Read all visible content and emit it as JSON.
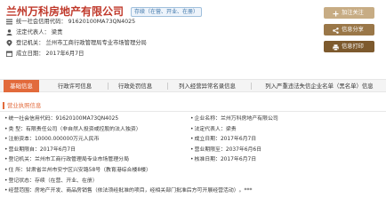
{
  "header": {
    "company_name": "兰州万科房地产有限公司",
    "status_badge": "存续（在营、开业、在册）",
    "credit_code_label": "统一社会信用代码：",
    "credit_code": "91620100MA73QN4025",
    "legal_rep_label": "法定代表人：",
    "legal_rep": "梁贵",
    "registry_label": "登记机关：",
    "registry": "兰州市工商行政管理局专业市场管理分局",
    "established_label": "成立日期：",
    "established": "2017年6月7日"
  },
  "actions": {
    "follow": "加注关注",
    "share": "信息分享",
    "print": "信息打印"
  },
  "tabs": [
    {
      "label": "基础信息"
    },
    {
      "label": "行政许可信息"
    },
    {
      "label": "行政处罚信息"
    },
    {
      "label": "列入经营异常名录信息"
    },
    {
      "label": "列入严重违法失信企业名单（黑名单）信息"
    }
  ],
  "section": {
    "title": "营业执照信息"
  },
  "details": {
    "credit_code_k": "统一社会信用代码：",
    "credit_code_v": "91620100MA73QN4025",
    "name_k": "企业名称：",
    "name_v": "兰州万科房地产有限公司",
    "type_k": "类    型：",
    "type_v": "有限责任公司（非自然人投资或控股的法人独资）",
    "legal_k": "法定代表人：",
    "legal_v": "梁贵",
    "capital_k": "注册资本：",
    "capital_v": "10000.000000万元人民币",
    "est_k": "成立日期：",
    "est_v": "2017年6月7日",
    "from_k": "营业期限自：",
    "from_v": "2017年6月7日",
    "to_k": "营业期限至：",
    "to_v": "2037年6月6日",
    "authority_k": "登记机关：",
    "authority_v": "兰州市工商行政管理局专业市场管理分局",
    "approve_k": "核准日期：",
    "approve_v": "2017年6月7日",
    "address_k": "住    所：",
    "address_v": "甘肃省兰州市安宁区兴安路58号（教育港综合楼8楼）",
    "status_k": "登记状态：",
    "status_v": "存续（在营、开业、在册）",
    "scope_k": "经营范围：",
    "scope_v": "房地产开发、商品房销售（依法须经批准的项目，经相关部门批准后方可开展经营活动）。***"
  },
  "colors": {
    "brand_red": "#c0392b",
    "tab_active": "#e26a3b",
    "btn_follow": "#c7ac84",
    "btn_share": "#9a7748",
    "btn_print": "#7d5a2e"
  }
}
